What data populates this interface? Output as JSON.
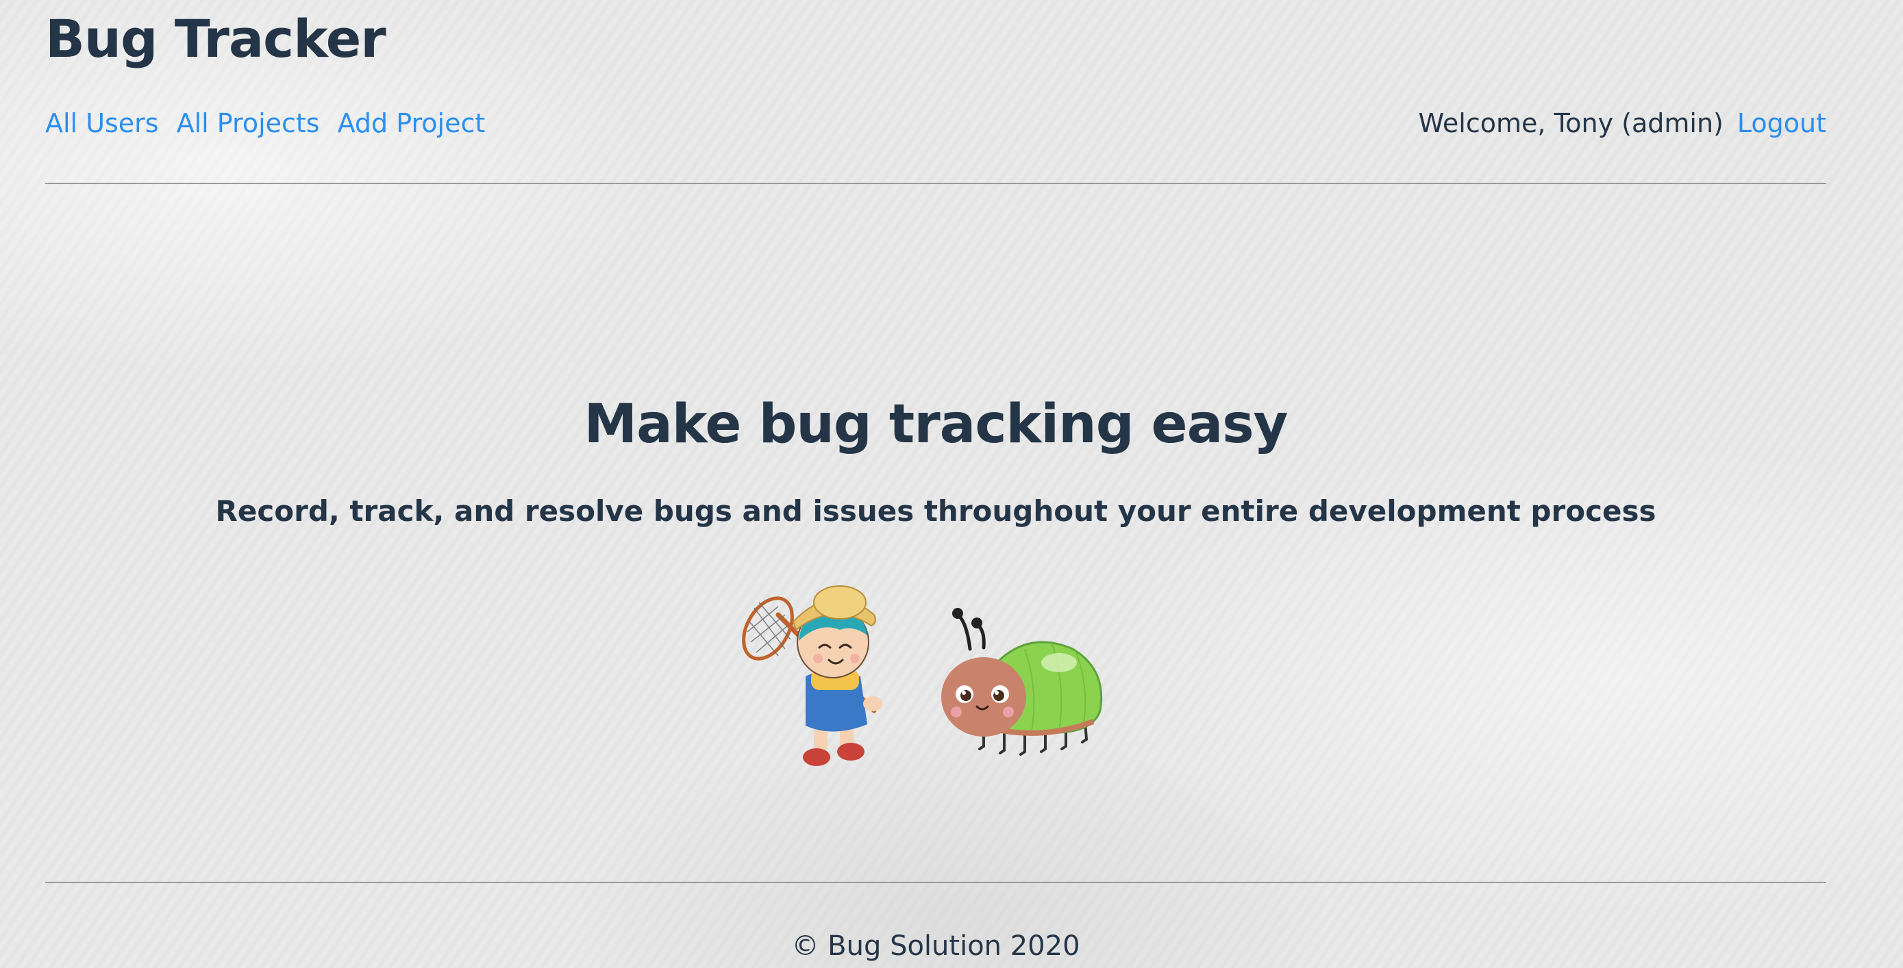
{
  "app": {
    "title": "Bug Tracker"
  },
  "nav": {
    "links": [
      {
        "label": "All Users"
      },
      {
        "label": "All Projects"
      },
      {
        "label": "Add Project"
      }
    ],
    "welcome": "Welcome, Tony (admin)",
    "logout": "Logout"
  },
  "hero": {
    "title": "Make bug tracking easy",
    "subtitle": "Record, track, and resolve bugs and issues throughout your entire development process"
  },
  "illustration": {
    "icons": [
      "boy-with-bug-net-icon",
      "ladybug-icon"
    ]
  },
  "footer": {
    "text": "© Bug Solution 2020"
  },
  "colors": {
    "link": "#2a8ff0",
    "text": "#243548",
    "rule": "#9a9a9a",
    "background": "#e9e9e9"
  }
}
